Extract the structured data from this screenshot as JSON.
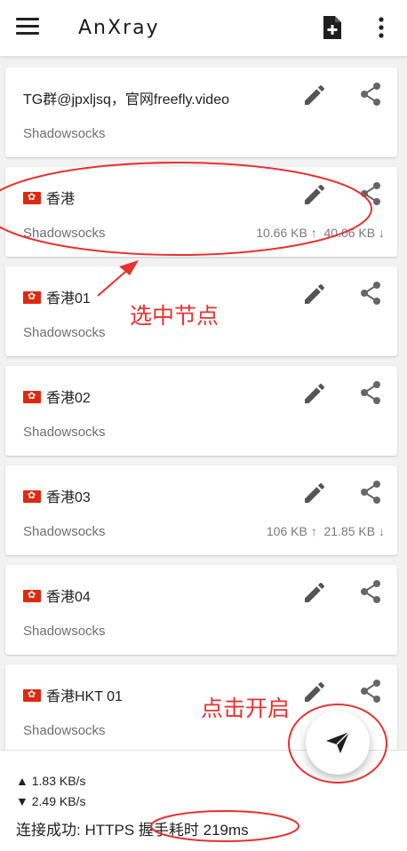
{
  "app": {
    "title": "AnXray"
  },
  "appbar": {
    "menu_icon": "menu-icon",
    "add_icon": "add-file-icon",
    "more_icon": "more-vert-icon"
  },
  "servers": [
    {
      "name": "TG群@jpxljsq，官网freefly.video",
      "type": "Shadowsocks",
      "flag": false,
      "upload": "",
      "download": ""
    },
    {
      "name": "香港",
      "type": "Shadowsocks",
      "flag": true,
      "upload": "10.66 KB ↑",
      "download": "40.06 KB ↓"
    },
    {
      "name": "香港01",
      "type": "Shadowsocks",
      "flag": true,
      "upload": "",
      "download": ""
    },
    {
      "name": "香港02",
      "type": "Shadowsocks",
      "flag": true,
      "upload": "",
      "download": ""
    },
    {
      "name": "香港03",
      "type": "Shadowsocks",
      "flag": true,
      "upload": "106 KB ↑",
      "download": "21.85 KB ↓"
    },
    {
      "name": "香港04",
      "type": "Shadowsocks",
      "flag": true,
      "upload": "",
      "download": ""
    },
    {
      "name": "香港HKT 01",
      "type": "Shadowsocks",
      "flag": true,
      "upload": "",
      "download": ""
    }
  ],
  "status": {
    "upload_speed": "▲  1.83 KB/s",
    "download_speed": "▼  2.49 KB/s",
    "connection": "连接成功: HTTPS 握手耗时 219ms"
  },
  "annotations": {
    "select_node": "选中节点",
    "click_start": "点击开启"
  },
  "colors": {
    "annotation": "#e8312f",
    "icon": "#555555",
    "flag": "#de2910"
  }
}
